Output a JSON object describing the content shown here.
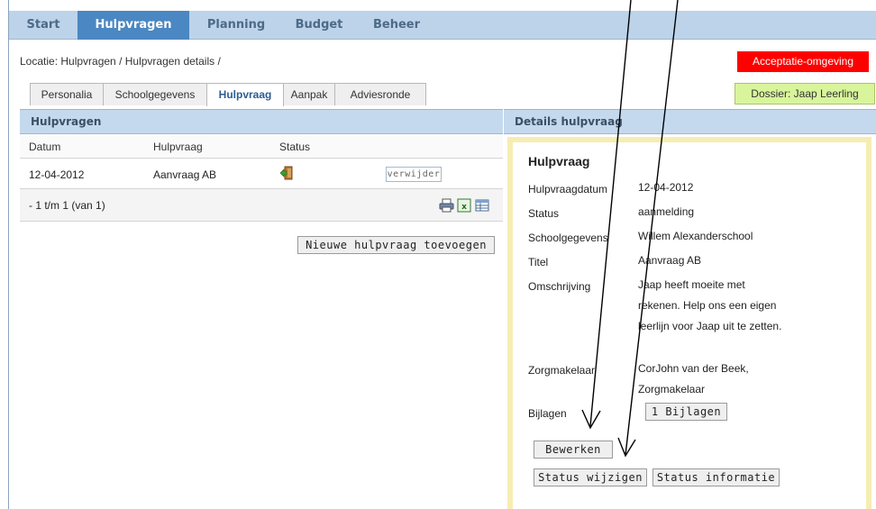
{
  "nav": {
    "items": [
      {
        "label": "Start"
      },
      {
        "label": "Hulpvragen"
      },
      {
        "label": "Planning"
      },
      {
        "label": "Budget"
      },
      {
        "label": "Beheer"
      }
    ],
    "active_index": 1
  },
  "breadcrumb": "Locatie: Hulpvragen / Hulpvragen details /",
  "env_badge": "Acceptatie-omgeving",
  "dossier_badge": "Dossier: Jaap Leerling",
  "tabs": [
    {
      "label": "Personalia"
    },
    {
      "label": "Schoolgegevens"
    },
    {
      "label": "Hulpvraag"
    },
    {
      "label": "Aanpak"
    },
    {
      "label": "Adviesronde"
    }
  ],
  "left_panel": {
    "title": "Hulpvragen",
    "columns": [
      "Datum",
      "Hulpvraag",
      "Status"
    ],
    "rows": [
      {
        "datum": "12-04-2012",
        "hulpvraag": "Aanvraag AB",
        "status_icon": "door-enter-icon",
        "delete_label": "verwijder"
      }
    ],
    "pager": "- 1 t/m 1 (van 1)",
    "export_icons": [
      "print-icon",
      "excel-icon",
      "table-icon"
    ],
    "add_button": "Nieuwe hulpvraag toevoegen"
  },
  "right_panel": {
    "title": "Details hulpvraag",
    "section_title": "Hulpvraag",
    "fields": {
      "hulpvraagdatum": {
        "label": "Hulpvraagdatum",
        "value": "12-04-2012"
      },
      "status": {
        "label": "Status",
        "value": "aanmelding"
      },
      "schoolgegevens": {
        "label": "Schoolgegevens",
        "value": "Willem Alexanderschool"
      },
      "titel": {
        "label": "Titel",
        "value": "Aanvraag AB"
      },
      "omschrijving": {
        "label": "Omschrijving",
        "value": "Jaap heeft moeite met rekenen. Help ons een eigen leerlijn voor Jaap uit te zetten."
      },
      "zorgmakelaar": {
        "label": "Zorgmakelaar",
        "value": "CorJohn van der Beek, Zorgmakelaar"
      },
      "bijlagen": {
        "label": "Bijlagen",
        "button": "1 Bijlagen"
      }
    },
    "buttons": {
      "bewerken": "Bewerken",
      "status_wijzigen": "Status wijzigen",
      "status_informatie": "Status informatie"
    }
  },
  "colors": {
    "nav_bg": "#bcd3ea",
    "nav_active": "#4b87c2",
    "env_badge": "#ff0000",
    "dossier_badge": "#d9f59b",
    "detail_border": "#f6edb2"
  }
}
